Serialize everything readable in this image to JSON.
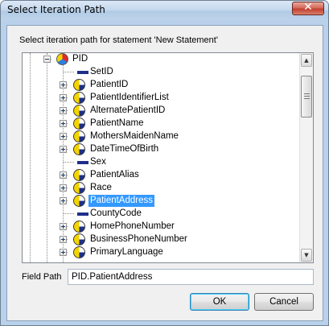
{
  "window": {
    "title": "Select Iteration Path",
    "close_glyph": "✕"
  },
  "instruction": "Select iteration path for statement 'New Statement'",
  "tree": {
    "root": {
      "label": "PID",
      "icon": "segment-root-icon",
      "expanded": true
    },
    "items": [
      {
        "label": "SetID",
        "icon": "field-dash-icon",
        "expandable": false,
        "selected": false
      },
      {
        "label": "PatientID",
        "icon": "composite-pie-icon",
        "expandable": true,
        "selected": false
      },
      {
        "label": "PatientIdentifierList",
        "icon": "composite-pie-icon",
        "expandable": true,
        "selected": false
      },
      {
        "label": "AlternatePatientID",
        "icon": "composite-pie-icon",
        "expandable": true,
        "selected": false
      },
      {
        "label": "PatientName",
        "icon": "composite-pie-icon",
        "expandable": true,
        "selected": false
      },
      {
        "label": "MothersMaidenName",
        "icon": "composite-pie-icon",
        "expandable": true,
        "selected": false
      },
      {
        "label": "DateTimeOfBirth",
        "icon": "composite-pie-icon",
        "expandable": true,
        "selected": false
      },
      {
        "label": "Sex",
        "icon": "field-dash-icon",
        "expandable": false,
        "selected": false
      },
      {
        "label": "PatientAlias",
        "icon": "composite-pie-icon",
        "expandable": true,
        "selected": false
      },
      {
        "label": "Race",
        "icon": "composite-pie-icon",
        "expandable": true,
        "selected": false
      },
      {
        "label": "PatientAddress",
        "icon": "composite-pie-icon",
        "expandable": true,
        "selected": true
      },
      {
        "label": "CountyCode",
        "icon": "field-dash-icon",
        "expandable": false,
        "selected": false
      },
      {
        "label": "HomePhoneNumber",
        "icon": "composite-pie-icon",
        "expandable": true,
        "selected": false
      },
      {
        "label": "BusinessPhoneNumber",
        "icon": "composite-pie-icon",
        "expandable": true,
        "selected": false
      },
      {
        "label": "PrimaryLanguage",
        "icon": "composite-pie-icon",
        "expandable": true,
        "selected": false
      }
    ]
  },
  "scrollbar": {
    "up_glyph": "▲",
    "down_glyph": "▼"
  },
  "field_path": {
    "label": "Field Path",
    "value": "PID.PatientAddress"
  },
  "buttons": {
    "ok": "OK",
    "cancel": "Cancel"
  },
  "colors": {
    "selection": "#3399ff",
    "field_icon": "#1d2f8a",
    "pie_yellow": "#f4d400",
    "close_red": "#c1402f"
  }
}
